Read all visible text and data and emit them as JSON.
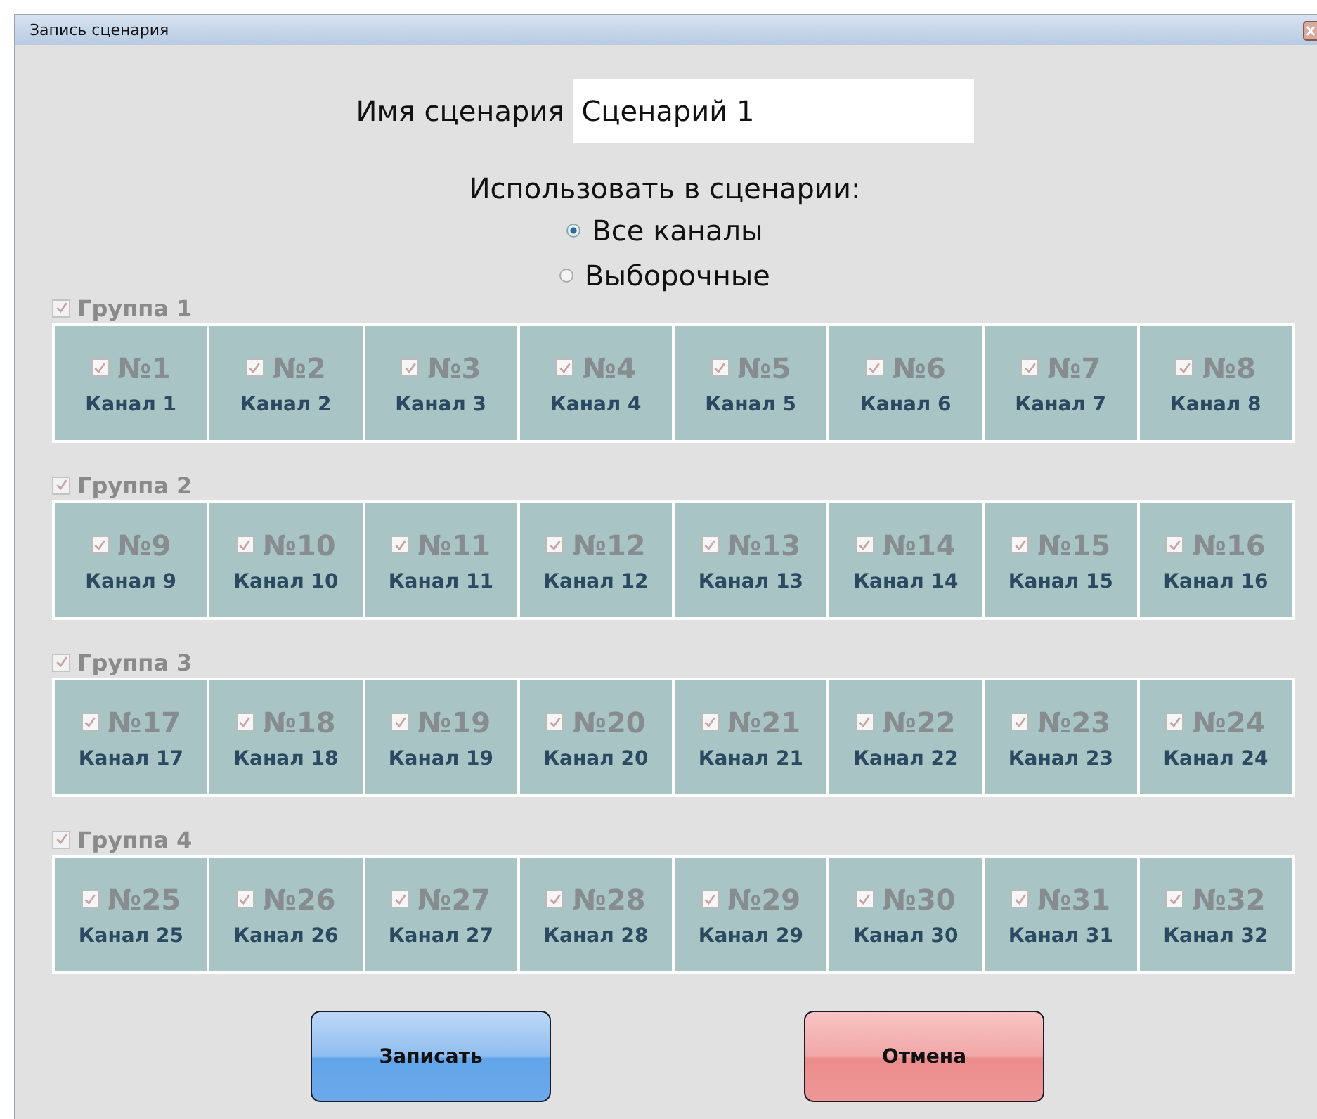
{
  "window": {
    "title": "Запись сценария"
  },
  "name_field": {
    "label": "Имя сценария",
    "value": "Сценарий 1"
  },
  "use_label": "Использовать в сценарии:",
  "radios": [
    {
      "label": "Все каналы",
      "selected": true
    },
    {
      "label": "Выборочные",
      "selected": false
    }
  ],
  "groups": [
    {
      "label": "Группа 1",
      "checked": true,
      "disabled": true,
      "channels": [
        {
          "number": "№1",
          "name": "Канал 1",
          "checked": true
        },
        {
          "number": "№2",
          "name": "Канал 2",
          "checked": true
        },
        {
          "number": "№3",
          "name": "Канал 3",
          "checked": true
        },
        {
          "number": "№4",
          "name": "Канал 4",
          "checked": true
        },
        {
          "number": "№5",
          "name": "Канал 5",
          "checked": true
        },
        {
          "number": "№6",
          "name": "Канал 6",
          "checked": true
        },
        {
          "number": "№7",
          "name": "Канал 7",
          "checked": true
        },
        {
          "number": "№8",
          "name": "Канал 8",
          "checked": true
        }
      ]
    },
    {
      "label": "Группа 2",
      "checked": true,
      "disabled": true,
      "channels": [
        {
          "number": "№9",
          "name": "Канал 9",
          "checked": true
        },
        {
          "number": "№10",
          "name": "Канал 10",
          "checked": true
        },
        {
          "number": "№11",
          "name": "Канал 11",
          "checked": true
        },
        {
          "number": "№12",
          "name": "Канал 12",
          "checked": true
        },
        {
          "number": "№13",
          "name": "Канал 13",
          "checked": true
        },
        {
          "number": "№14",
          "name": "Канал 14",
          "checked": true
        },
        {
          "number": "№15",
          "name": "Канал 15",
          "checked": true
        },
        {
          "number": "№16",
          "name": "Канал 16",
          "checked": true
        }
      ]
    },
    {
      "label": "Группа 3",
      "checked": true,
      "disabled": true,
      "channels": [
        {
          "number": "№17",
          "name": "Канал 17",
          "checked": true
        },
        {
          "number": "№18",
          "name": "Канал 18",
          "checked": true
        },
        {
          "number": "№19",
          "name": "Канал 19",
          "checked": true
        },
        {
          "number": "№20",
          "name": "Канал 20",
          "checked": true
        },
        {
          "number": "№21",
          "name": "Канал 21",
          "checked": true
        },
        {
          "number": "№22",
          "name": "Канал 22",
          "checked": true
        },
        {
          "number": "№23",
          "name": "Канал 23",
          "checked": true
        },
        {
          "number": "№24",
          "name": "Канал 24",
          "checked": true
        }
      ]
    },
    {
      "label": "Группа 4",
      "checked": true,
      "disabled": true,
      "channels": [
        {
          "number": "№25",
          "name": "Канал 25",
          "checked": true
        },
        {
          "number": "№26",
          "name": "Канал 26",
          "checked": true
        },
        {
          "number": "№27",
          "name": "Канал 27",
          "checked": true
        },
        {
          "number": "№28",
          "name": "Канал 28",
          "checked": true
        },
        {
          "number": "№29",
          "name": "Канал 29",
          "checked": true
        },
        {
          "number": "№30",
          "name": "Канал 30",
          "checked": true
        },
        {
          "number": "№31",
          "name": "Канал 31",
          "checked": true
        },
        {
          "number": "№32",
          "name": "Канал 32",
          "checked": true
        }
      ]
    }
  ],
  "buttons": [
    {
      "label": "Записать",
      "kind": "confirm"
    },
    {
      "label": "Отмена",
      "kind": "cancel"
    }
  ]
}
